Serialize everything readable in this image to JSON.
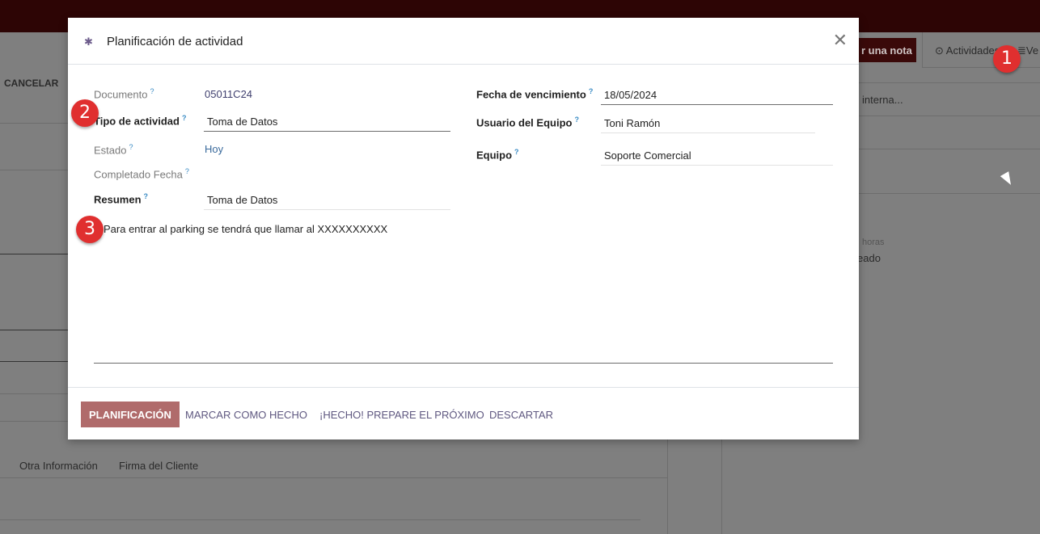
{
  "background": {
    "cancel_label": "CANCELAR",
    "note_button": "r una nota",
    "activities_tab": "Actividades",
    "view_tab": "Ve",
    "internal_placeholder": "interna...",
    "hours_label": "horas",
    "created_text": "eado",
    "tabs": [
      "Otra Información",
      "Firma del Cliente"
    ]
  },
  "badges": [
    "1",
    "2",
    "3"
  ],
  "modal": {
    "title": "Planificación de actividad",
    "icon": "bug-icon",
    "left_fields": [
      {
        "label": "Documento",
        "value": "05011C24"
      },
      {
        "label": "Tipo de actividad",
        "value": "Toma de Datos"
      },
      {
        "label": "Estado",
        "value": "Hoy"
      },
      {
        "label": "Completado Fecha",
        "value": ""
      },
      {
        "label": "Resumen",
        "value": "Toma de Datos"
      }
    ],
    "right_fields": [
      {
        "label": "Fecha de vencimiento",
        "value": "18/05/2024"
      },
      {
        "label": "Usuario del Equipo",
        "value": "Toni Ramón"
      },
      {
        "label": "Equipo",
        "value": "Soporte Comercial"
      }
    ],
    "tooltip_mark": "?",
    "note": "Para entrar al parking se tendrá que llamar al XXXXXXXXXX",
    "buttons": {
      "schedule": "Planificación",
      "mark_done": "Marcar como hecho",
      "done_next": "¡Hecho! Prepare el próximo",
      "discard": "Descartar"
    }
  },
  "colors": {
    "primary": "#b06b6b",
    "topbar": "#2d0505",
    "badge": "#e02f2f"
  }
}
